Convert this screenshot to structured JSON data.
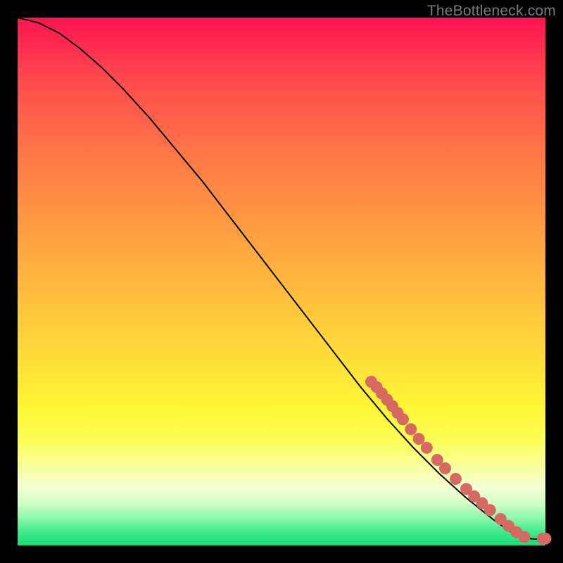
{
  "watermark": "TheBottleneck.com",
  "colors": {
    "dot": "#d66a63",
    "curve": "#000000",
    "page_bg": "#000000"
  },
  "chart_data": {
    "type": "line",
    "title": "",
    "xlabel": "",
    "ylabel": "",
    "xlim": [
      0,
      100
    ],
    "ylim": [
      0,
      100
    ],
    "grid": false,
    "legend": false,
    "curve": [
      {
        "x": 0,
        "y": 100
      },
      {
        "x": 4,
        "y": 99
      },
      {
        "x": 8,
        "y": 97
      },
      {
        "x": 12,
        "y": 94
      },
      {
        "x": 16,
        "y": 90.5
      },
      {
        "x": 20,
        "y": 86.5
      },
      {
        "x": 25,
        "y": 81
      },
      {
        "x": 30,
        "y": 75
      },
      {
        "x": 35,
        "y": 69
      },
      {
        "x": 40,
        "y": 62.5
      },
      {
        "x": 45,
        "y": 56
      },
      {
        "x": 50,
        "y": 49.5
      },
      {
        "x": 55,
        "y": 43
      },
      {
        "x": 60,
        "y": 36.5
      },
      {
        "x": 65,
        "y": 30
      },
      {
        "x": 70,
        "y": 24
      },
      {
        "x": 75,
        "y": 18.5
      },
      {
        "x": 80,
        "y": 13.5
      },
      {
        "x": 85,
        "y": 9
      },
      {
        "x": 90,
        "y": 5
      },
      {
        "x": 93,
        "y": 2.8
      },
      {
        "x": 96,
        "y": 1.4
      },
      {
        "x": 98,
        "y": 1.2
      },
      {
        "x": 100,
        "y": 1.2
      }
    ],
    "points": [
      {
        "x": 67,
        "y": 31
      },
      {
        "x": 68,
        "y": 30
      },
      {
        "x": 69,
        "y": 28.8
      },
      {
        "x": 70,
        "y": 27.6
      },
      {
        "x": 71,
        "y": 26.4
      },
      {
        "x": 72,
        "y": 25.1
      },
      {
        "x": 73,
        "y": 23.9
      },
      {
        "x": 74.5,
        "y": 22
      },
      {
        "x": 76,
        "y": 20.2
      },
      {
        "x": 77.5,
        "y": 18.5
      },
      {
        "x": 79.5,
        "y": 16.2
      },
      {
        "x": 81,
        "y": 14.6
      },
      {
        "x": 83,
        "y": 12.6
      },
      {
        "x": 85,
        "y": 10.7
      },
      {
        "x": 86.5,
        "y": 9.3
      },
      {
        "x": 88,
        "y": 8
      },
      {
        "x": 89.5,
        "y": 6.7
      },
      {
        "x": 91.5,
        "y": 5
      },
      {
        "x": 93,
        "y": 3.7
      },
      {
        "x": 94.5,
        "y": 2.5
      },
      {
        "x": 96,
        "y": 1.6
      },
      {
        "x": 99.5,
        "y": 1.3
      },
      {
        "x": 100,
        "y": 1.3
      }
    ]
  }
}
